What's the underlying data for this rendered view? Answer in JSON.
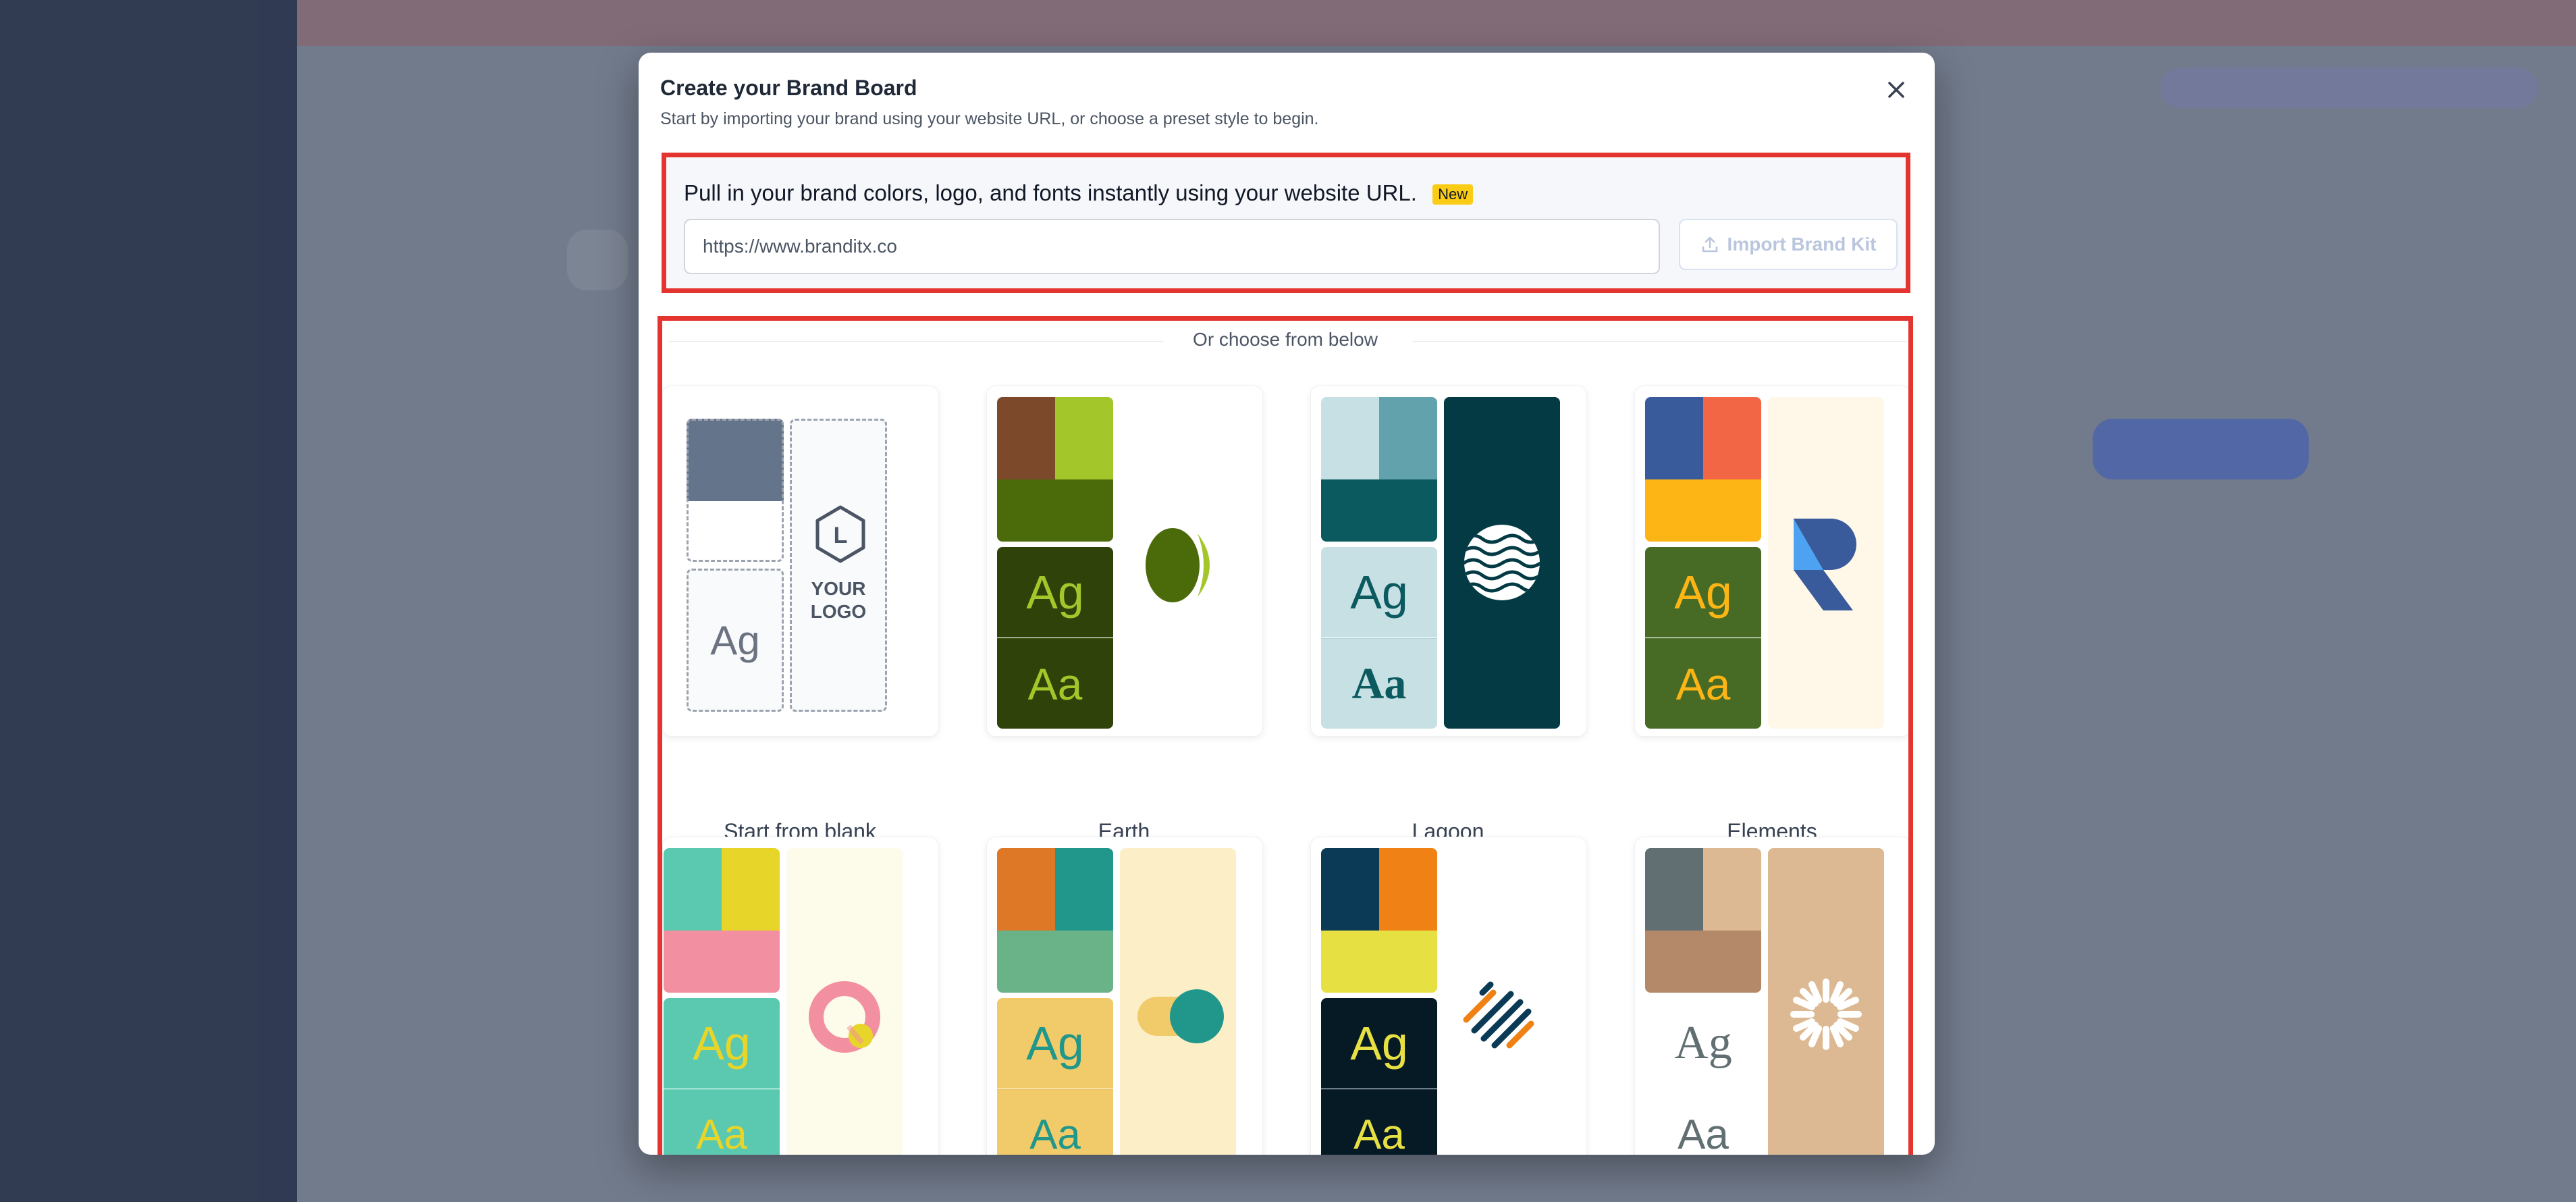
{
  "modal": {
    "title": "Create your Brand Board",
    "subtitle": "Start by importing your brand using your website URL, or choose a preset style to begin.",
    "close_icon": "close-icon"
  },
  "import": {
    "heading": "Pull in your brand colors, logo, and fonts instantly using your website URL.",
    "badge": "New",
    "url_value": "https://www.branditx.co",
    "button_label": "Import Brand Kit",
    "button_icon": "upload-icon"
  },
  "presets": {
    "divider_text": "Or choose from below",
    "ag": "Ag",
    "aa": "Aa",
    "blank_logo_text": [
      "YOUR",
      "LOGO"
    ],
    "blank_logo_letter": "L",
    "items": [
      {
        "label": "Start from blank",
        "colors": [
          "#64748b",
          "#ffffff"
        ]
      },
      {
        "label": "Earth",
        "colors": [
          "#7c4a2a",
          "#a3c62a",
          "#4b6b0a",
          "#2f4209"
        ]
      },
      {
        "label": "Lagoon",
        "colors": [
          "#c6e0e4",
          "#62a2ad",
          "#0b5a5f",
          "#043a44"
        ]
      },
      {
        "label": "Elements",
        "colors": [
          "#3a5b9b",
          "#f26645",
          "#fcb514",
          "#476b24"
        ]
      },
      {
        "label": "",
        "colors": [
          "#5bc9b0",
          "#e8d52a",
          "#f28fa0",
          "#fdfbea"
        ]
      },
      {
        "label": "",
        "colors": [
          "#df7826",
          "#21978b",
          "#6ab389",
          "#f1cb6a"
        ]
      },
      {
        "label": "",
        "colors": [
          "#0b3a56",
          "#f08114",
          "#e7e042",
          "#061a26"
        ]
      },
      {
        "label": "",
        "colors": [
          "#626f72",
          "#dcb993",
          "#b4896a",
          "#ffffff"
        ]
      }
    ]
  }
}
